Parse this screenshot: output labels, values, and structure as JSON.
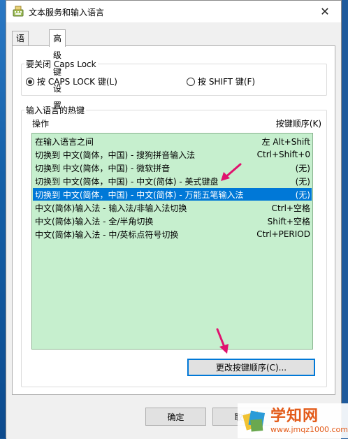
{
  "window": {
    "title": "文本服务和输入语言",
    "close_glyph": "✕"
  },
  "tabs": [
    {
      "label": "语言栏",
      "active": false
    },
    {
      "label": "高级键设置",
      "active": true
    }
  ],
  "caps_lock_group": {
    "legend": "要关闭 Caps Lock",
    "options": [
      {
        "label": "按 CAPS LOCK 键(L)",
        "checked": true
      },
      {
        "label": "按 SHIFT 键(F)",
        "checked": false
      }
    ]
  },
  "hotkeys_group": {
    "legend": "输入语言的热键",
    "col_action": "操作",
    "col_sequence": "按键顺序(K)",
    "rows": [
      {
        "action": "在输入语言之间",
        "keys": "左 Alt+Shift",
        "selected": false
      },
      {
        "action": "切换到 中文(简体，中国) - 搜狗拼音输入法",
        "keys": "Ctrl+Shift+0",
        "selected": false
      },
      {
        "action": "切换到 中文(简体，中国) - 微软拼音",
        "keys": "(无)",
        "selected": false
      },
      {
        "action": "切换到 中文(简体，中国) - 中文(简体) - 美式键盘",
        "keys": "(无)",
        "selected": false
      },
      {
        "action": "切换到 中文(简体，中国) - 中文(简体) - 万能五笔输入法",
        "keys": "(无)",
        "selected": true
      },
      {
        "action": "中文(简体)输入法 - 输入法/非输入法切换",
        "keys": "Ctrl+空格",
        "selected": false
      },
      {
        "action": "中文(简体)输入法 - 全/半角切换",
        "keys": "Shift+空格",
        "selected": false
      },
      {
        "action": "中文(简体)输入法 - 中/英标点符号切换",
        "keys": "Ctrl+PERIOD",
        "selected": false
      }
    ],
    "change_sequence_button": "更改按键顺序(C)..."
  },
  "footer": {
    "ok_button": "确定",
    "cancel_button": "取消"
  },
  "watermark": {
    "brand": "学知网",
    "url": "www.jmqz1000.com"
  },
  "colors": {
    "list_bg": "#c6efce",
    "selection": "#0078d7",
    "arrow": "#e0126e"
  }
}
